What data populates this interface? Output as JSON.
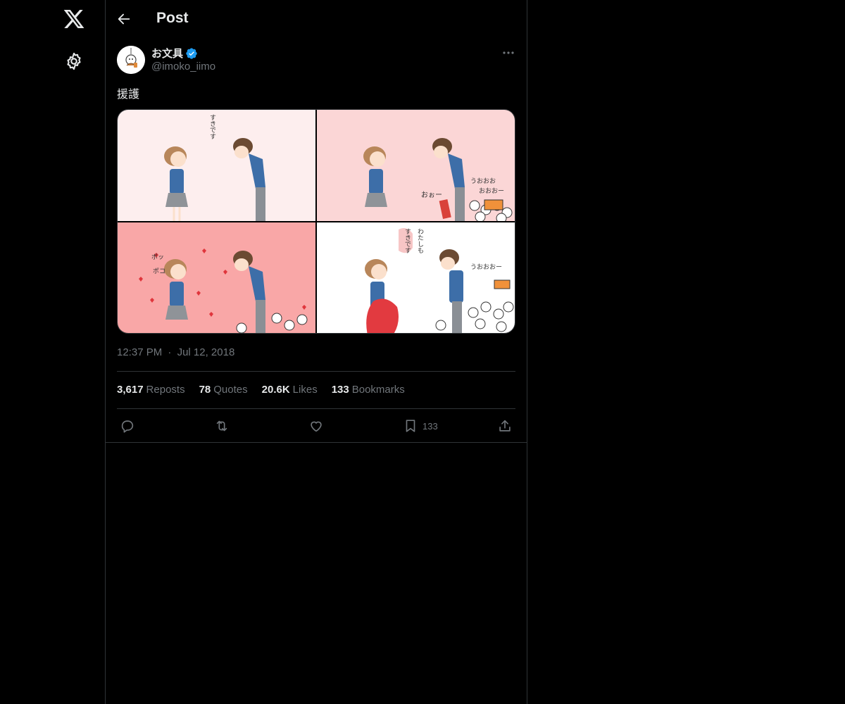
{
  "nav": {
    "logo_icon": "x-logo-icon",
    "settings_icon": "gear-icon"
  },
  "header": {
    "title": "Post",
    "back_icon": "arrow-left-icon"
  },
  "post": {
    "author": {
      "display_name": "お文具",
      "handle": "@imoko_iimo",
      "verified": true
    },
    "text": "援護",
    "timestamp": "12:37 PM",
    "separator": "·",
    "date": "Jul 12, 2018",
    "media_text": {
      "p1_text": "すきです",
      "p2_text_a": "おぉー",
      "p2_text_b": "うおおお",
      "p2_text_c": "おおおー",
      "p3_text_a": "ポッ",
      "p3_text_b": "ポコ",
      "p4_text_a": "わたしも",
      "p4_text_b": "すきです",
      "p4_text_c": "うおおおー"
    }
  },
  "stats": [
    {
      "num": "3,617",
      "label": "Reposts"
    },
    {
      "num": "78",
      "label": "Quotes"
    },
    {
      "num": "20.6K",
      "label": "Likes"
    },
    {
      "num": "133",
      "label": "Bookmarks"
    }
  ],
  "actions": {
    "reply_icon": "reply-icon",
    "repost_icon": "repost-icon",
    "like_icon": "heart-icon",
    "bookmark_icon": "bookmark-icon",
    "bookmark_count": "133",
    "share_icon": "share-icon"
  },
  "colors": {
    "background": "#000000",
    "text": "#e7e9ea",
    "muted": "#71767b",
    "border": "#2f3336",
    "verified": "#1d9bf0"
  }
}
